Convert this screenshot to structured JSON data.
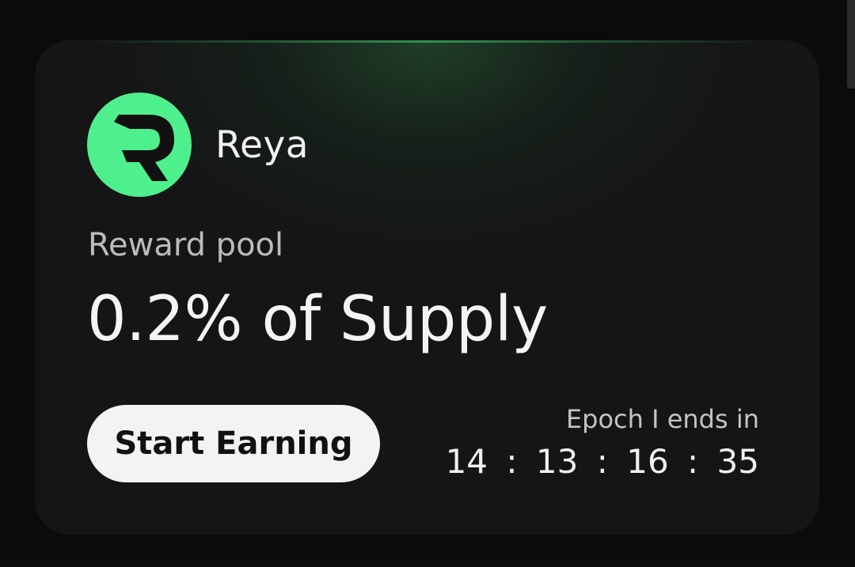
{
  "brand": {
    "name": "Reya",
    "logo_icon": "reya-r-logo-icon",
    "logo_color": "#4ef08e"
  },
  "reward": {
    "label": "Reward pool",
    "value": "0.2% of Supply"
  },
  "cta": {
    "label": "Start Earning"
  },
  "epoch": {
    "label": "Epoch I ends in",
    "countdown": {
      "days": "14",
      "hours": "13",
      "minutes": "16",
      "seconds": "35",
      "separator": ":"
    }
  },
  "colors": {
    "accent": "#4ef08e",
    "card_bg": "#151515",
    "page_bg": "#0b0b0b"
  }
}
